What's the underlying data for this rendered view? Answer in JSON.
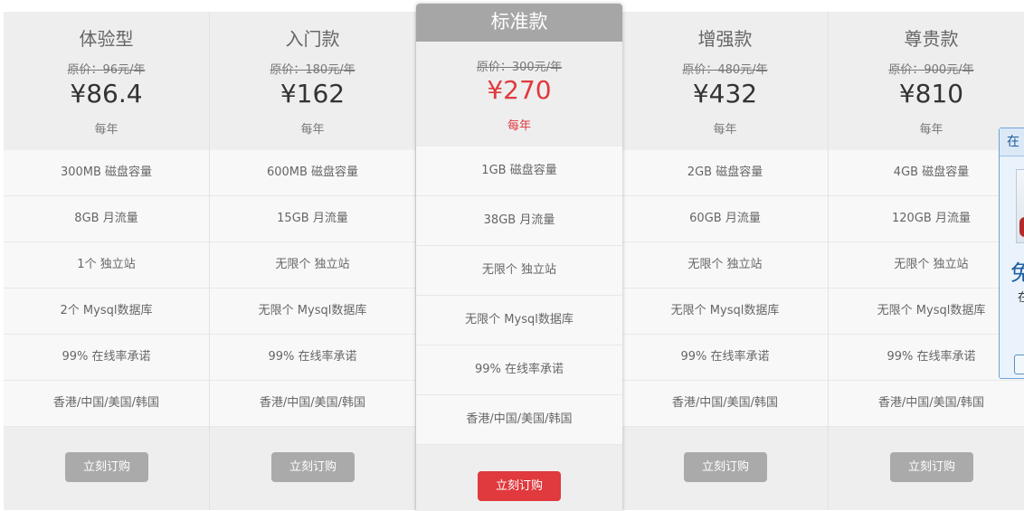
{
  "plans": [
    {
      "name": "体验型",
      "original_price": "原价：96元/年",
      "price": "¥86.4",
      "period": "每年",
      "features": [
        "300MB 磁盘容量",
        "8GB 月流量",
        "1个 独立站",
        "2个 Mysql数据库",
        "99% 在线率承诺",
        "香港/中国/美国/韩国"
      ],
      "button": "立刻订购"
    },
    {
      "name": "入门款",
      "original_price": "原价：180元/年",
      "price": "¥162",
      "period": "每年",
      "features": [
        "600MB 磁盘容量",
        "15GB 月流量",
        "无限个 独立站",
        "无限个 Mysql数据库",
        "99% 在线率承诺",
        "香港/中国/美国/韩国"
      ],
      "button": "立刻订购"
    },
    {
      "name": "增强款",
      "original_price": "原价：480元/年",
      "price": "¥432",
      "period": "每年",
      "features": [
        "2GB 磁盘容量",
        "60GB 月流量",
        "无限个 独立站",
        "无限个 Mysql数据库",
        "99% 在线率承诺",
        "香港/中国/美国/韩国"
      ],
      "button": "立刻订购"
    },
    {
      "name": "尊贵款",
      "original_price": "原价：900元/年",
      "price": "¥810",
      "period": "每年",
      "features": [
        "4GB 磁盘容量",
        "120GB 月流量",
        "无限个 独立站",
        "无限个 Mysql数据库",
        "99% 在线率承诺",
        "香港/中国/美国/韩国"
      ],
      "button": "立刻订购"
    }
  ],
  "featured": {
    "name": "标准款",
    "original_price": "原价：300元/年",
    "price": "¥270",
    "period": "每年",
    "features": [
      "1GB 磁盘容量",
      "38GB 月流量",
      "无限个 独立站",
      "无限个 Mysql数据库",
      "99% 在线率承诺",
      "香港/中国/美国/韩国"
    ],
    "button": "立刻订购"
  },
  "side_widget": {
    "title": "在",
    "big_text": "免",
    "small_text": "在"
  },
  "colors": {
    "accent_red": "#e0393e",
    "button_gray": "#aaaaaa",
    "header_gray": "#a6a6a6"
  }
}
